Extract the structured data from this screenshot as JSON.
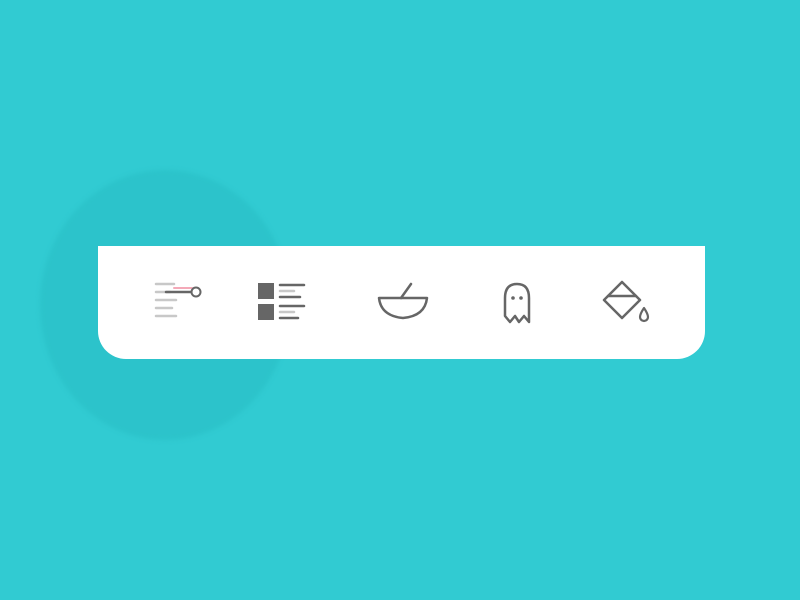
{
  "colors": {
    "background": "#31cbd2",
    "ripple": "#28bec5",
    "tabbar": "#ffffff",
    "icon": "#666666",
    "icon_light": "#c8c8c8",
    "active_accent": "#f4a9b8"
  },
  "tabbar": {
    "active_index": 0,
    "tabs": [
      {
        "icon": "settings-slider-icon"
      },
      {
        "icon": "list-view-icon"
      },
      {
        "icon": "mortar-pestle-icon"
      },
      {
        "icon": "ghost-icon"
      },
      {
        "icon": "paint-bucket-icon"
      }
    ]
  }
}
